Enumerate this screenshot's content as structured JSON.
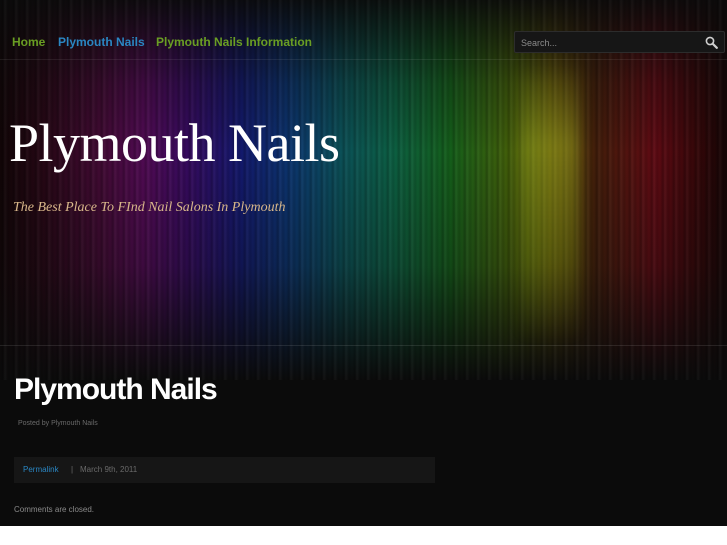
{
  "nav": {
    "items": [
      {
        "label": "Home"
      },
      {
        "label": "Plymouth Nails"
      },
      {
        "label": "Plymouth Nails Information"
      }
    ]
  },
  "search": {
    "placeholder": "Search..."
  },
  "header": {
    "site_title": "Plymouth Nails",
    "tagline": "The Best Place To FInd Nail Salons In Plymouth"
  },
  "post": {
    "title": "Plymouth Nails",
    "byline": "Posted by Plymouth Nails",
    "permalink_label": "Permalink",
    "separator": "|",
    "date": "March 9th, 2011",
    "comments_status": "Comments are closed."
  },
  "colors": {
    "nav_green": "#6a9e23",
    "link_blue": "#2a86c2",
    "background": "#0b0b0b"
  }
}
